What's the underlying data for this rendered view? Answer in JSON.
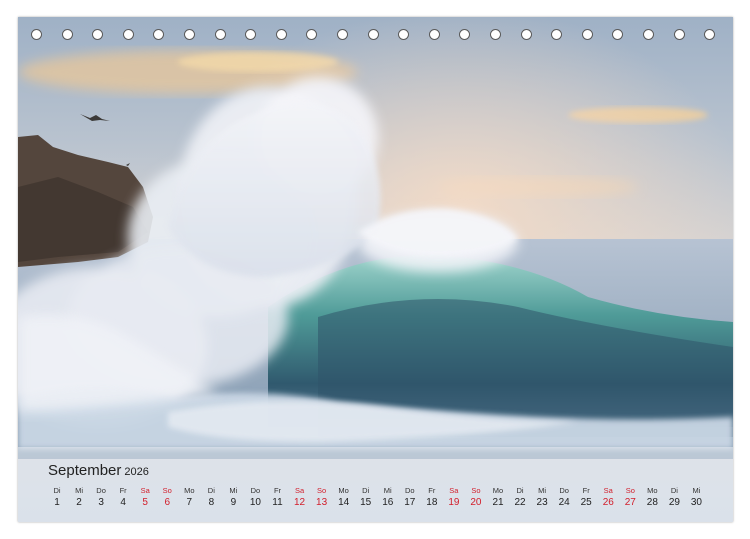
{
  "calendar": {
    "month": "September",
    "year": "2026",
    "ring_count": 23,
    "weekend_color": "#d21e2b",
    "days": [
      {
        "wd": "Di",
        "d": "1",
        "we": false
      },
      {
        "wd": "Mi",
        "d": "2",
        "we": false
      },
      {
        "wd": "Do",
        "d": "3",
        "we": false
      },
      {
        "wd": "Fr",
        "d": "4",
        "we": false
      },
      {
        "wd": "Sa",
        "d": "5",
        "we": true
      },
      {
        "wd": "So",
        "d": "6",
        "we": true
      },
      {
        "wd": "Mo",
        "d": "7",
        "we": false
      },
      {
        "wd": "Di",
        "d": "8",
        "we": false
      },
      {
        "wd": "Mi",
        "d": "9",
        "we": false
      },
      {
        "wd": "Do",
        "d": "10",
        "we": false
      },
      {
        "wd": "Fr",
        "d": "11",
        "we": false
      },
      {
        "wd": "Sa",
        "d": "12",
        "we": true
      },
      {
        "wd": "So",
        "d": "13",
        "we": true
      },
      {
        "wd": "Mo",
        "d": "14",
        "we": false
      },
      {
        "wd": "Di",
        "d": "15",
        "we": false
      },
      {
        "wd": "Mi",
        "d": "16",
        "we": false
      },
      {
        "wd": "Do",
        "d": "17",
        "we": false
      },
      {
        "wd": "Fr",
        "d": "18",
        "we": false
      },
      {
        "wd": "Sa",
        "d": "19",
        "we": true
      },
      {
        "wd": "So",
        "d": "20",
        "we": true
      },
      {
        "wd": "Mo",
        "d": "21",
        "we": false
      },
      {
        "wd": "Di",
        "d": "22",
        "we": false
      },
      {
        "wd": "Mi",
        "d": "23",
        "we": false
      },
      {
        "wd": "Do",
        "d": "24",
        "we": false
      },
      {
        "wd": "Fr",
        "d": "25",
        "we": false
      },
      {
        "wd": "Sa",
        "d": "26",
        "we": true
      },
      {
        "wd": "So",
        "d": "27",
        "we": true
      },
      {
        "wd": "Mo",
        "d": "28",
        "we": false
      },
      {
        "wd": "Di",
        "d": "29",
        "we": false
      },
      {
        "wd": "Mi",
        "d": "30",
        "we": false
      }
    ]
  }
}
